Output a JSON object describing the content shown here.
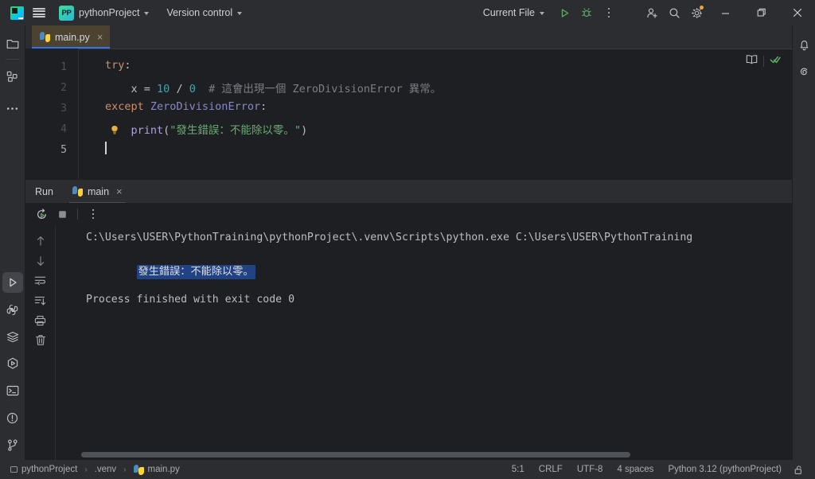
{
  "titlebar": {
    "logo_icon": "pycharm-logo-icon",
    "menu_icon": "hamburger-menu-icon",
    "project_badge": "PP",
    "project_name": "pythonProject",
    "version_control": "Version control",
    "run_config": "Current File",
    "run_icon": "run-play-icon",
    "debug_icon": "debug-bug-icon",
    "more_icon": "more-vertical-icon",
    "add_user_icon": "add-user-icon",
    "search_icon": "search-icon",
    "settings_icon": "settings-gear-icon",
    "minimize_icon": "minimize-icon",
    "maximize_icon": "maximize-restore-icon",
    "close_icon": "close-icon"
  },
  "left_rail": {
    "top": [
      {
        "name": "project-tool-window",
        "icon": "folder-icon"
      },
      {
        "name": "structure-tool-window",
        "icon": "structure-grid-icon"
      },
      {
        "name": "more-tool-windows",
        "icon": "more-horizontal-icon"
      }
    ],
    "bottom": [
      {
        "name": "run-tool-window",
        "icon": "run-play-icon",
        "active": true
      },
      {
        "name": "python-packages-tool-window",
        "icon": "python-icon"
      },
      {
        "name": "services-tool-window",
        "icon": "layers-icon"
      },
      {
        "name": "python-console-tool-window",
        "icon": "hexagon-play-icon"
      },
      {
        "name": "terminal-tool-window",
        "icon": "terminal-icon"
      },
      {
        "name": "problems-tool-window",
        "icon": "warning-circle-icon"
      },
      {
        "name": "version-control-tool-window",
        "icon": "git-branch-icon"
      }
    ]
  },
  "right_rail": [
    {
      "name": "notifications",
      "icon": "bell-icon"
    },
    {
      "name": "ai-assistant",
      "icon": "spiral-icon"
    }
  ],
  "editor": {
    "tab": {
      "label": "main.py",
      "icon": "python-icon",
      "close": "×"
    },
    "reader_mode_icon": "book-icon",
    "inspections_icon": "checkmark-icon",
    "line_numbers": [
      "1",
      "2",
      "3",
      "4",
      "5"
    ],
    "current_line": "5",
    "intention_bulb_icon": "lightbulb-icon",
    "code_lines": [
      {
        "n": "1",
        "tokens": [
          {
            "t": "try",
            "c": "k-kw"
          },
          {
            "t": ":",
            "c": "k-def"
          }
        ]
      },
      {
        "n": "2",
        "tokens": [
          {
            "t": "    x ",
            "c": "k-def"
          },
          {
            "t": "= ",
            "c": "k-def"
          },
          {
            "t": "10 ",
            "c": "k-num"
          },
          {
            "t": "/ ",
            "c": "k-def"
          },
          {
            "t": "0",
            "c": "k-num"
          },
          {
            "t": "  # 這會出現一個 ZeroDivisionError 異常。",
            "c": "k-cmt"
          }
        ]
      },
      {
        "n": "3",
        "tokens": [
          {
            "t": "except ",
            "c": "k-kw"
          },
          {
            "t": "ZeroDivisionError",
            "c": "k-cls"
          },
          {
            "t": ":",
            "c": "k-def"
          }
        ]
      },
      {
        "n": "4",
        "tokens": [
          {
            "t": "    ",
            "c": "k-def"
          },
          {
            "t": "print",
            "c": "k-call"
          },
          {
            "t": "(",
            "c": "k-def"
          },
          {
            "t": "\"發生錯誤：不能除以零。\"",
            "c": "k-str"
          },
          {
            "t": ")",
            "c": "k-def"
          }
        ]
      },
      {
        "n": "5",
        "tokens": []
      }
    ]
  },
  "run_window": {
    "title": "Run",
    "tab_label": "main",
    "tab_icon": "python-icon",
    "tab_close": "×",
    "toolbar": [
      {
        "name": "rerun-button",
        "icon": "rerun-icon"
      },
      {
        "name": "stop-button",
        "icon": "stop-square-icon"
      },
      {
        "name": "run-options-button",
        "icon": "more-vertical-icon"
      }
    ],
    "console_gutter": [
      {
        "name": "previous-occurrence-button",
        "icon": "arrow-up-icon"
      },
      {
        "name": "next-occurrence-button",
        "icon": "arrow-down-icon"
      },
      {
        "name": "soft-wrap-button",
        "icon": "soft-wrap-icon"
      },
      {
        "name": "scroll-to-end-button",
        "icon": "scroll-to-end-icon"
      },
      {
        "name": "print-button",
        "icon": "printer-icon"
      },
      {
        "name": "clear-all-button",
        "icon": "trash-icon"
      }
    ],
    "console_output": {
      "command": "C:\\Users\\USER\\PythonTraining\\pythonProject\\.venv\\Scripts\\python.exe C:\\Users\\USER\\PythonTraining",
      "result_selected": "發生錯誤：不能除以零。",
      "exit_message": "Process finished with exit code 0"
    }
  },
  "statusbar": {
    "breadcrumb": [
      {
        "label": "pythonProject",
        "icon": "folder-icon"
      },
      {
        "label": ".venv",
        "icon": ""
      },
      {
        "label": "main.py",
        "icon": "python-icon"
      }
    ],
    "separator": "›",
    "caret_position": "5:1",
    "line_separator": "CRLF",
    "encoding": "UTF-8",
    "indent": "4 spaces",
    "interpreter": "Python 3.12 (pythonProject)",
    "lock_icon": "unlocked-icon"
  },
  "colors": {
    "accent_blue": "#3574f0",
    "selection_blue": "#214283",
    "green_run": "#5fad65",
    "tab_active_bg": "#4b4230",
    "notification_dot": "#f0a732"
  }
}
